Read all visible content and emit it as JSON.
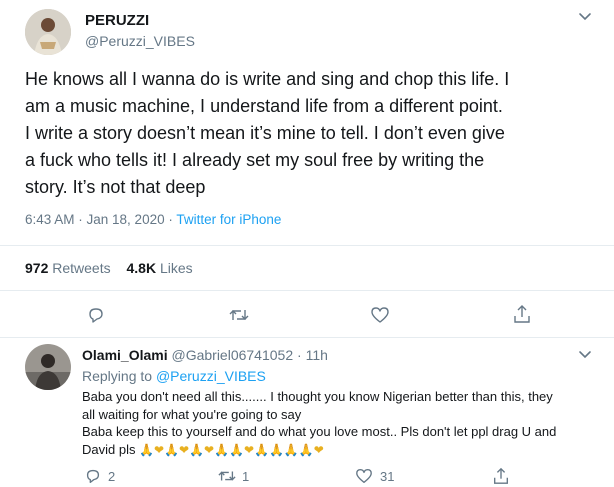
{
  "tweet": {
    "author_name": "PERUZZI",
    "author_handle": "@Peruzzi_VIBES",
    "text_lines": [
      "He knows all I wanna do is write and sing and chop this life. I",
      "am a music machine, I understand life from a different point.",
      "I write a story doesn’t mean it’s mine to tell. I don’t even give",
      "a fuck who tells it! I already set my soul free by writing the",
      "story. It’s not that deep"
    ],
    "time": "6:43 AM · Jan 18, 2020 · ",
    "source": "Twitter for iPhone",
    "retweets_count": "972",
    "retweets_label": "Retweets",
    "likes_count": "4.8K",
    "likes_label": "Likes"
  },
  "reply": {
    "author_name": "Olami_Olami",
    "author_handle": "@Gabriel06741052",
    "time": "· 11h",
    "replying_prefix": "Replying to ",
    "replying_handle": "@Peruzzi_VIBES",
    "text_lines": [
      "Baba you don't need all this....... I thought you know Nigerian better than this, they",
      "all waiting for what you're going to say",
      "Baba keep this to yourself and do what you love most.. Pls don't let ppl drag U and"
    ],
    "last_line_prefix": "David pls ",
    "emoji_line": "🙏❤🙏❤🙏❤🙏🙏❤🙏🙏🙏🙏❤",
    "reply_count": "2",
    "retweet_count": "1",
    "like_count": "31"
  },
  "colors": {
    "accent": "#1da1f2",
    "muted": "#657786",
    "like": "#e0245e"
  },
  "icons": [
    "chevron-down-icon",
    "reply-icon",
    "retweet-icon",
    "like-icon",
    "share-icon"
  ]
}
